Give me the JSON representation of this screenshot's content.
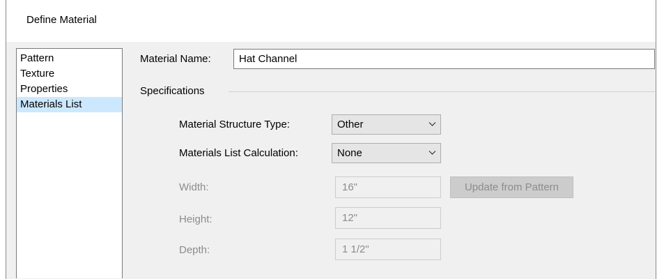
{
  "window": {
    "title": "Define Material"
  },
  "nav": {
    "items": [
      {
        "label": "Pattern"
      },
      {
        "label": "Texture"
      },
      {
        "label": "Properties"
      },
      {
        "label": "Materials List",
        "selected": true
      }
    ]
  },
  "form": {
    "material_name_label": "Material Name:",
    "material_name_value": "Hat Channel",
    "specifications_label": "Specifications",
    "structure_type_label": "Material Structure Type:",
    "structure_type_value": "Other",
    "calculation_label": "Materials List Calculation:",
    "calculation_value": "None",
    "width_label": "Width:",
    "width_value": "16\"",
    "update_button_label": "Update from Pattern",
    "height_label": "Height:",
    "height_value": "12\"",
    "depth_label": "Depth:",
    "depth_value": "1 1/2\""
  },
  "colors": {
    "selected_item_bg": "#cce8ff",
    "dialog_bg": "#f0f0f0",
    "disabled_text": "#8c8c8c"
  }
}
